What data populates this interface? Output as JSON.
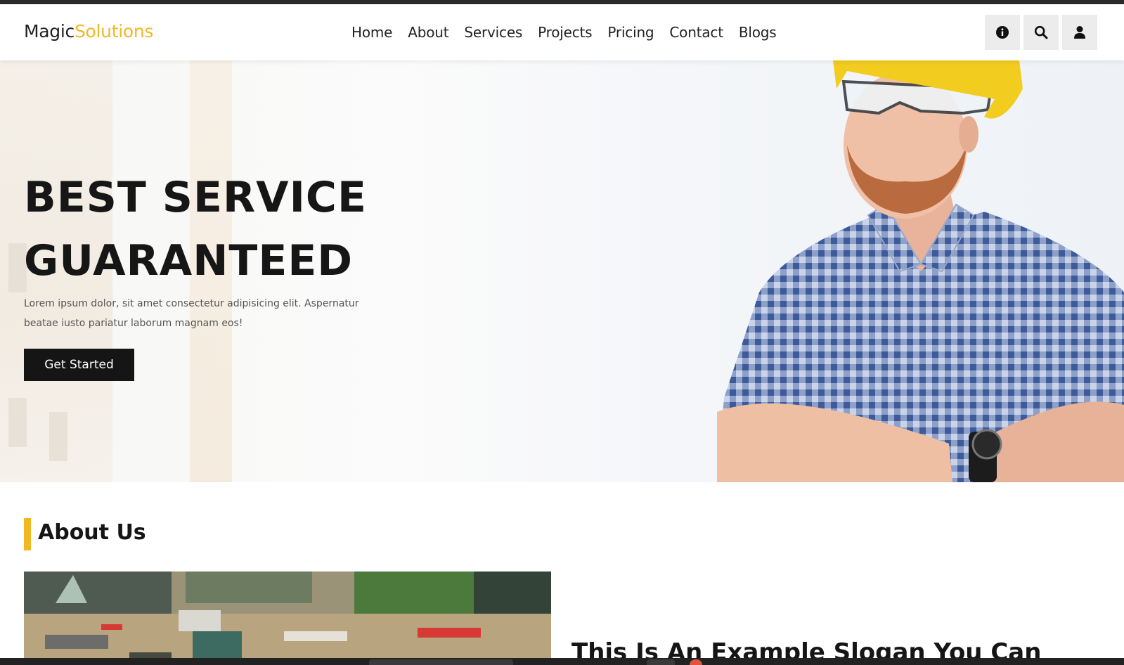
{
  "brand": {
    "part1": "Magic",
    "part2": "Solutions",
    "accent_color": "#f2b824"
  },
  "nav": {
    "items": [
      {
        "label": "Home"
      },
      {
        "label": "About"
      },
      {
        "label": "Services"
      },
      {
        "label": "Projects"
      },
      {
        "label": "Pricing"
      },
      {
        "label": "Contact"
      },
      {
        "label": "Blogs"
      }
    ]
  },
  "header_icons": [
    "info-icon",
    "search-icon",
    "user-icon"
  ],
  "hero": {
    "title_line1": "BEST SERVICE",
    "title_line2": "GUARANTEED",
    "text_line1": "Lorem ipsum dolor, sit amet consectetur adipisicing elit. Aspernatur",
    "text_line2": "beatae iusto pariatur laborum magnam eos!",
    "cta_label": "Get Started"
  },
  "about": {
    "title": "About Us",
    "slogan": "This Is An Example Slogan You Can"
  }
}
